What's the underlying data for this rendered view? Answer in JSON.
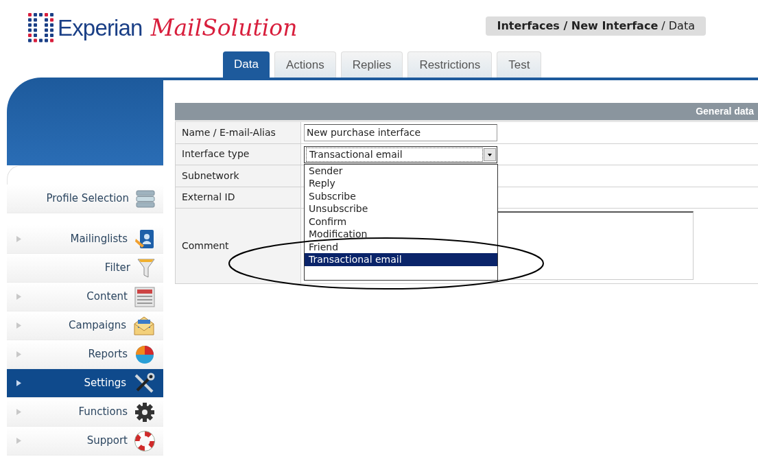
{
  "logo": {
    "brand": "Experian",
    "product": "MailSolution"
  },
  "breadcrumb": "**Interfaces / New Interface** / Data",
  "tabs": [
    {
      "label": "Data",
      "selected": true
    },
    {
      "label": "Actions",
      "selected": false
    },
    {
      "label": "Replies",
      "selected": false
    },
    {
      "label": "Restrictions",
      "selected": false
    },
    {
      "label": "Test",
      "selected": false
    }
  ],
  "sidebar": {
    "items": [
      {
        "label": "Profile Selection",
        "expandable": false,
        "selected": false
      },
      {
        "label": "Mailinglists",
        "expandable": true,
        "selected": false
      },
      {
        "label": "Filter",
        "expandable": false,
        "selected": false
      },
      {
        "label": "Content",
        "expandable": true,
        "selected": false
      },
      {
        "label": "Campaigns",
        "expandable": true,
        "selected": false
      },
      {
        "label": "Reports",
        "expandable": true,
        "selected": false
      },
      {
        "label": "Settings",
        "expandable": true,
        "selected": true
      },
      {
        "label": "Functions",
        "expandable": true,
        "selected": false
      },
      {
        "label": "Support",
        "expandable": true,
        "selected": false
      }
    ]
  },
  "form": {
    "title": "General data",
    "rows": [
      {
        "label": "Name / E-mail-Alias",
        "kind": "text",
        "value": "New purchase interface"
      },
      {
        "label": "Interface type",
        "kind": "select",
        "value": "Transactional email",
        "expanded": true,
        "options": [
          {
            "label": "Sender",
            "selected": false
          },
          {
            "label": "Reply",
            "selected": false
          },
          {
            "label": "Subscribe",
            "selected": false
          },
          {
            "label": "Unsubscribe",
            "selected": false
          },
          {
            "label": "Confirm",
            "selected": false
          },
          {
            "label": "Modification",
            "selected": false
          },
          {
            "label": "Friend",
            "selected": false
          },
          {
            "label": "Transactional email",
            "selected": true
          }
        ]
      },
      {
        "label": "Subnetwork",
        "kind": "empty"
      },
      {
        "label": "External ID",
        "kind": "empty"
      },
      {
        "label": "Comment",
        "kind": "textarea"
      }
    ]
  }
}
